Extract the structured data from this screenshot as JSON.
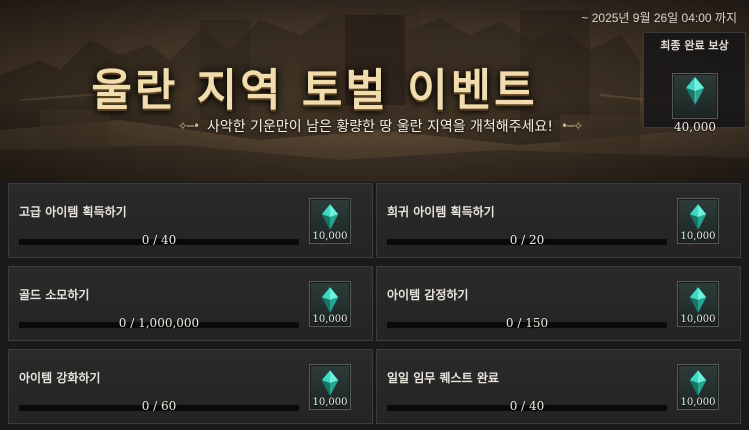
{
  "event": {
    "period": "~ 2025년 9월 26일 04:00 까지",
    "title": "울란 지역 토벌 이벤트",
    "subtitle": "사악한 기운만이 남은 황량한 땅 울란 지역을 개척해주세요!",
    "ornament_left": "✧─•",
    "ornament_right": "•─✧"
  },
  "final_reward": {
    "label": "최종 완료 보상",
    "amount": "40,000",
    "icon": "crystal-icon"
  },
  "missions": [
    {
      "task": "고급 아이템 획득하기",
      "progress": "0 / 40",
      "fraction": 0,
      "reward": "10,000"
    },
    {
      "task": "희귀 아이템 획득하기",
      "progress": "0 / 20",
      "fraction": 0,
      "reward": "10,000"
    },
    {
      "task": "골드 소모하기",
      "progress": "0 / 1,000,000",
      "fraction": 0,
      "reward": "10,000"
    },
    {
      "task": "아이템 감정하기",
      "progress": "0 / 150",
      "fraction": 0,
      "reward": "10,000"
    },
    {
      "task": "아이템 강화하기",
      "progress": "0 / 60",
      "fraction": 0,
      "reward": "10,000"
    },
    {
      "task": "일일 임무 퀘스트 완료",
      "progress": "0 / 40",
      "fraction": 0,
      "reward": "10,000"
    }
  ],
  "colors": {
    "title_gold": "#f0dcae",
    "bar_track": "#0a0a0a",
    "bar_fill": "#c9a550",
    "crystal": "#3fd7c0"
  }
}
